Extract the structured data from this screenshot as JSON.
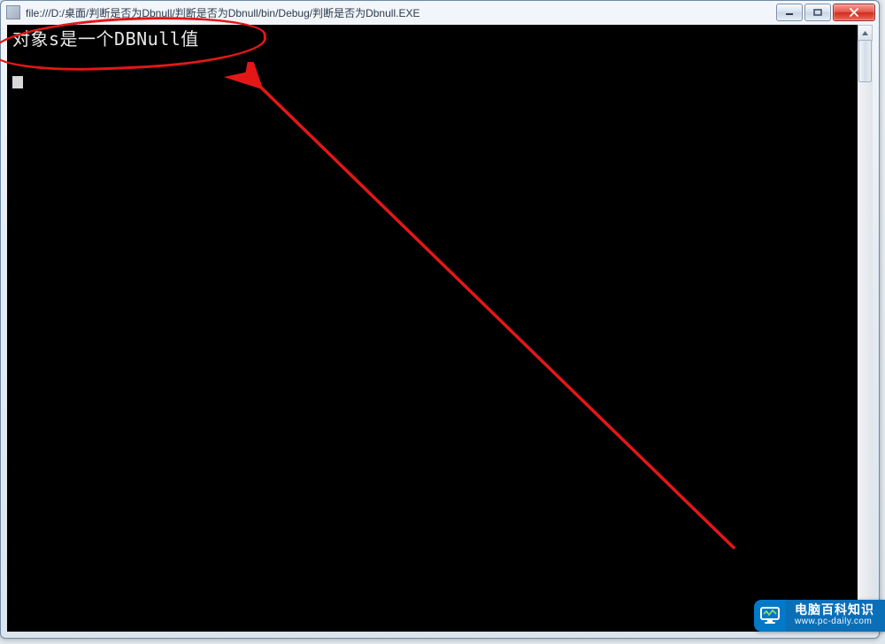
{
  "window": {
    "title": "file:///D:/桌面/判断是否为Dbnull/判断是否为Dbnull/bin/Debug/判断是否为Dbnull.EXE",
    "buttons": {
      "minimize": "Minimize",
      "maximize": "Maximize",
      "close": "Close"
    }
  },
  "console": {
    "line1": "对象s是一个DBNull值"
  },
  "watermark": {
    "title": "电脑百科知识",
    "url": "www.pc-daily.com"
  },
  "annotation": {
    "ellipse_color": "#e41717",
    "arrow_color": "#e41717"
  }
}
